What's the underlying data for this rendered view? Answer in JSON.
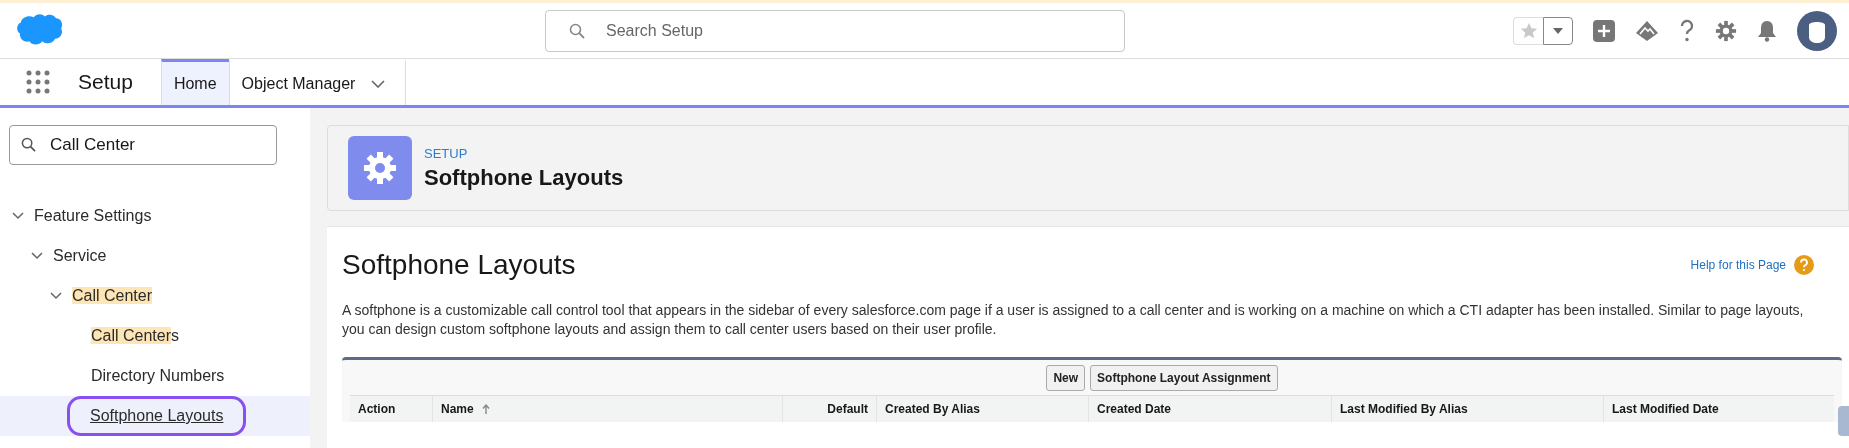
{
  "header": {
    "search": {
      "placeholder": "Search Setup"
    }
  },
  "nav": {
    "app_name": "Setup",
    "tabs": [
      {
        "label": "Home",
        "selected": true,
        "kind": "plain"
      },
      {
        "label": "Object Manager",
        "selected": false,
        "kind": "menu"
      }
    ]
  },
  "sidebar": {
    "search": {
      "value": "Call Center"
    },
    "tree": [
      {
        "segments": [
          {
            "text": "Feature Settings",
            "highlighted": false
          }
        ],
        "expanded": true,
        "selected": false,
        "children": [
          {
            "segments": [
              {
                "text": "Service",
                "highlighted": false
              }
            ],
            "expanded": true,
            "selected": false,
            "children": [
              {
                "segments": [
                  {
                    "text": "Call Center",
                    "highlighted": true
                  }
                ],
                "expanded": true,
                "selected": false,
                "children": [
                  {
                    "segments": [
                      {
                        "text": "Call Center",
                        "highlighted": true
                      },
                      {
                        "text": "s",
                        "highlighted": false
                      }
                    ],
                    "selected": false
                  },
                  {
                    "segments": [
                      {
                        "text": "Directory Numbers",
                        "highlighted": false
                      }
                    ],
                    "selected": false
                  },
                  {
                    "segments": [
                      {
                        "text": "Softphone Layouts",
                        "highlighted": false
                      }
                    ],
                    "selected": true,
                    "circled": true
                  }
                ]
              }
            ]
          }
        ]
      }
    ]
  },
  "page_header": {
    "eyebrow": "SETUP",
    "title": "Softphone Layouts"
  },
  "content": {
    "title": "Softphone Layouts",
    "help_link": "Help for this Page",
    "description": "A softphone is a customizable call control tool that appears in the sidebar of every salesforce.com page if a user is assigned to a call center and is working on a machine on which a CTI adapter has been installed. Similar to page layouts, you can design custom softphone layouts and assign them to call center users based on their user profile.",
    "buttons": [
      "New",
      "Softphone Layout Assignment"
    ],
    "table": {
      "columns": [
        {
          "label": "Action",
          "sorted": false
        },
        {
          "label": "Name",
          "sorted": true
        },
        {
          "label": "Default",
          "sorted": false
        },
        {
          "label": "Created By Alias",
          "sorted": false
        },
        {
          "label": "Created Date",
          "sorted": false
        },
        {
          "label": "Last Modified By Alias",
          "sorted": false
        },
        {
          "label": "Last Modified Date",
          "sorted": false
        }
      ]
    }
  }
}
